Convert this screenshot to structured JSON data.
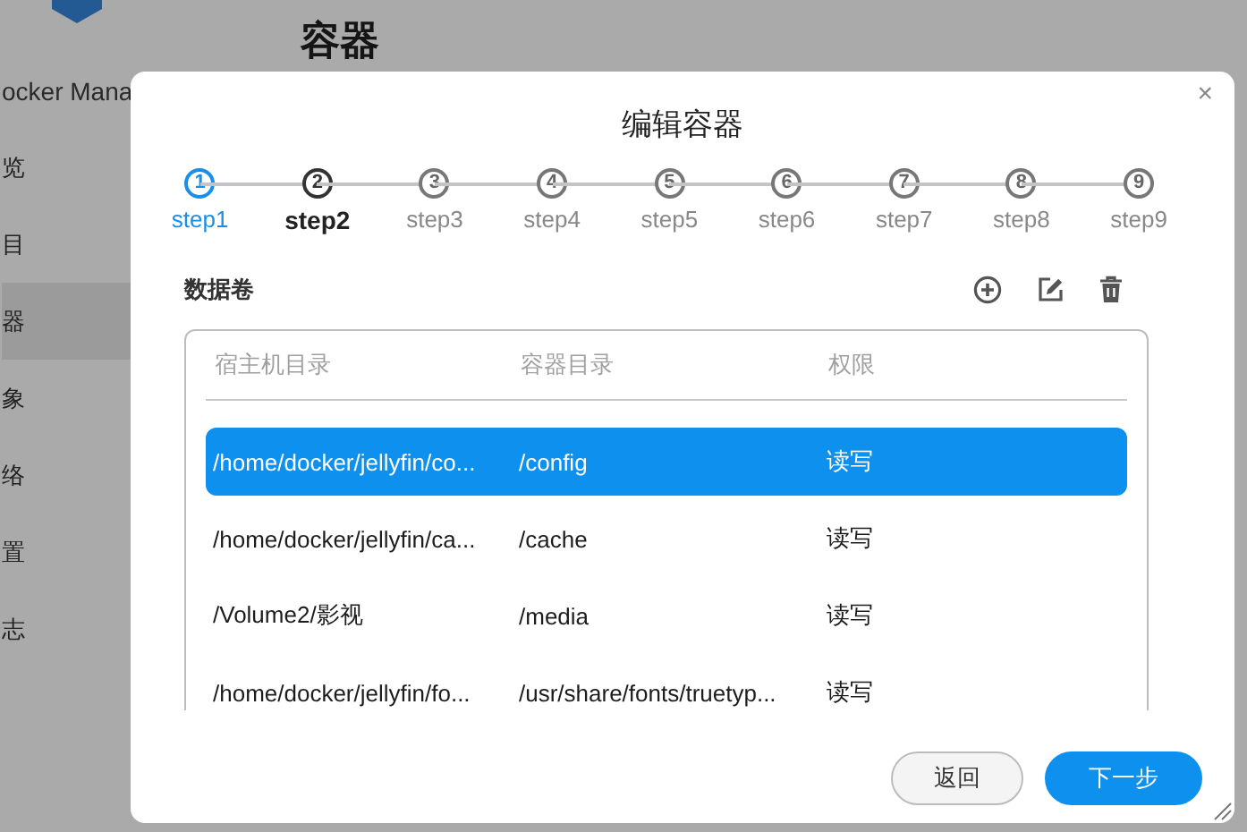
{
  "app": {
    "brand": "ocker Mana",
    "heading": "容器"
  },
  "sidebar": {
    "items": [
      {
        "label": "览",
        "selected": false
      },
      {
        "label": "目",
        "selected": false
      },
      {
        "label": "器",
        "selected": true
      },
      {
        "label": "象",
        "selected": false
      },
      {
        "label": "络",
        "selected": false
      },
      {
        "label": "置",
        "selected": false
      },
      {
        "label": "志",
        "selected": false
      }
    ]
  },
  "dialog": {
    "title": "编辑容器",
    "close": "×",
    "steps": [
      {
        "number": "1",
        "label": "step1",
        "done": true,
        "selected": false
      },
      {
        "number": "2",
        "label": "step2",
        "done": false,
        "selected": true
      },
      {
        "number": "3",
        "label": "step3",
        "done": false,
        "selected": false
      },
      {
        "number": "4",
        "label": "step4",
        "done": false,
        "selected": false
      },
      {
        "number": "5",
        "label": "step5",
        "done": false,
        "selected": false
      },
      {
        "number": "6",
        "label": "step6",
        "done": false,
        "selected": false
      },
      {
        "number": "7",
        "label": "step7",
        "done": false,
        "selected": false
      },
      {
        "number": "8",
        "label": "step8",
        "done": false,
        "selected": false
      },
      {
        "number": "9",
        "label": "step9",
        "done": false,
        "selected": false
      }
    ],
    "section": {
      "title": "数据卷"
    },
    "table": {
      "columns": [
        "宿主机目录",
        "容器目录",
        "权限"
      ],
      "rows": [
        {
          "cells": [
            "/home/docker/jellyfin/co...",
            "/config",
            "读写"
          ],
          "selected": true
        },
        {
          "cells": [
            "/home/docker/jellyfin/ca...",
            "/cache",
            "读写"
          ],
          "selected": false
        },
        {
          "cells": [
            "/Volume2/影视",
            "/media",
            "读写"
          ],
          "selected": false
        },
        {
          "cells": [
            "/home/docker/jellyfin/fo...",
            "/usr/share/fonts/truetyp...",
            "读写"
          ],
          "selected": false
        }
      ]
    },
    "buttons": [
      {
        "label": "返回",
        "kind": "secondary"
      },
      {
        "label": "下一步",
        "kind": "primary"
      }
    ]
  }
}
